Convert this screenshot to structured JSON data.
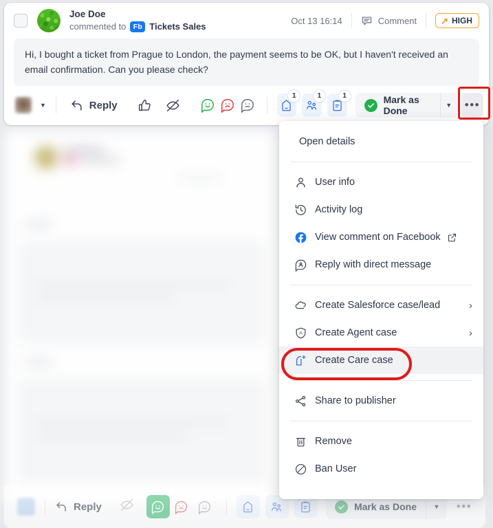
{
  "comment": {
    "author": "Joe Doe",
    "action_prefix": "commented to",
    "channel_badge": "Fb",
    "channel_name": "Tickets Sales",
    "timestamp": "Oct 13 16:14",
    "type_label": "Comment",
    "priority_label": "HIGH",
    "priority_color": "#f0a52a",
    "body": "Hi, I bought a ticket from Prague to London, the payment seems to be OK, but I haven't received an email confirmation. Can you please check?"
  },
  "toolbar": {
    "reply_label": "Reply",
    "icons": [
      {
        "name": "thumbs-up-icon"
      },
      {
        "name": "hide-icon"
      },
      {
        "name": "sentiment-positive-icon",
        "color": "#22b14c"
      },
      {
        "name": "sentiment-negative-icon",
        "color": "#e03b3b"
      },
      {
        "name": "sentiment-neutral-icon",
        "color": "#6b7280"
      }
    ],
    "counters": [
      {
        "name": "tag-icon",
        "count": "1"
      },
      {
        "name": "assignee-icon",
        "count": "1"
      },
      {
        "name": "note-icon",
        "count": "1"
      }
    ],
    "mark_done_label": "Mark as Done",
    "more_label": "•••"
  },
  "bottom_toolbar": {
    "reply_label": "Reply",
    "mark_done_label": "Mark as Done",
    "more_label": "•••"
  },
  "menu": {
    "groups": [
      {
        "items": [
          {
            "label": "Open details",
            "icon": null,
            "submenu": false,
            "external": false,
            "highlighted": false
          }
        ]
      },
      {
        "items": [
          {
            "label": "User info",
            "icon": "user-icon",
            "submenu": false,
            "external": false,
            "highlighted": false
          },
          {
            "label": "Activity log",
            "icon": "history-icon",
            "submenu": false,
            "external": false,
            "highlighted": false
          },
          {
            "label": "View comment on Facebook",
            "icon": "facebook-icon",
            "submenu": false,
            "external": true,
            "highlighted": false
          },
          {
            "label": "Reply with direct message",
            "icon": "direct-message-icon",
            "submenu": false,
            "external": false,
            "highlighted": false
          }
        ]
      },
      {
        "items": [
          {
            "label": "Create Salesforce case/lead",
            "icon": "salesforce-cloud-icon",
            "submenu": true,
            "external": false,
            "highlighted": false
          },
          {
            "label": "Create Agent case",
            "icon": "agent-shield-icon",
            "submenu": true,
            "external": false,
            "highlighted": false
          },
          {
            "label": "Create Care case",
            "icon": "care-case-icon",
            "submenu": false,
            "external": false,
            "highlighted": true
          }
        ]
      },
      {
        "items": [
          {
            "label": "Share to publisher",
            "icon": "share-icon",
            "submenu": false,
            "external": false,
            "highlighted": false
          }
        ]
      },
      {
        "items": [
          {
            "label": "Remove",
            "icon": "trash-icon",
            "submenu": false,
            "external": false,
            "highlighted": false
          },
          {
            "label": "Ban User",
            "icon": "ban-icon",
            "submenu": false,
            "external": false,
            "highlighted": false
          }
        ]
      }
    ],
    "submenu_arrow": "›"
  },
  "annotations": {
    "color": "#e01b1b",
    "targets": [
      "more-options-button",
      "create-care-case-menu-item"
    ]
  }
}
